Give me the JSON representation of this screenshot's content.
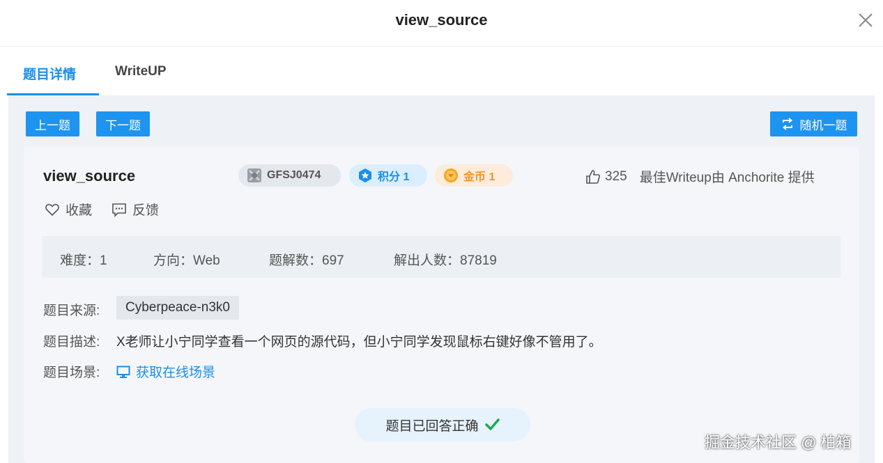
{
  "header": {
    "title": "view_source"
  },
  "tabs": [
    {
      "label": "题目详情",
      "active": true
    },
    {
      "label": "WriteUP",
      "active": false
    }
  ],
  "nav": {
    "prev_label": "上一题",
    "next_label": "下一题",
    "random_label": "随机一题"
  },
  "challenge": {
    "name": "view_source",
    "id": "GFSJ0474",
    "score_label": "积分 1",
    "coin_label": "金币 1",
    "likes": "325",
    "best_writeup": "最佳Writeup由 Anchorite 提供",
    "favorite_label": "收藏",
    "feedback_label": "反馈"
  },
  "stats": {
    "difficulty": "难度：1",
    "direction": "方向：Web",
    "writeups": "题解数：697",
    "solvers": "解出人数：87819"
  },
  "details": {
    "source_label": "题目来源:",
    "source_value": "Cyberpeace-n3k0",
    "desc_label": "题目描述:",
    "desc_value": "X老师让小宁同学查看一个网页的源代码，但小宁同学发现鼠标右键好像不管用了。",
    "scene_label": "题目场景:",
    "scene_link": "获取在线场景"
  },
  "status": {
    "answered": "题目已回答正确"
  },
  "watermark": "掘金技术社区 @ 柏箱",
  "colors": {
    "accent": "#1d8ee8",
    "button": "#1d94ef",
    "coin": "#f0961e",
    "success": "#1fa853"
  },
  "icons": [
    "close-icon",
    "shuffle-icon",
    "id-badge-icon",
    "star-badge-icon",
    "coin-icon",
    "thumbs-up-icon",
    "heart-icon",
    "comment-icon",
    "monitor-icon",
    "checkmark-icon"
  ]
}
